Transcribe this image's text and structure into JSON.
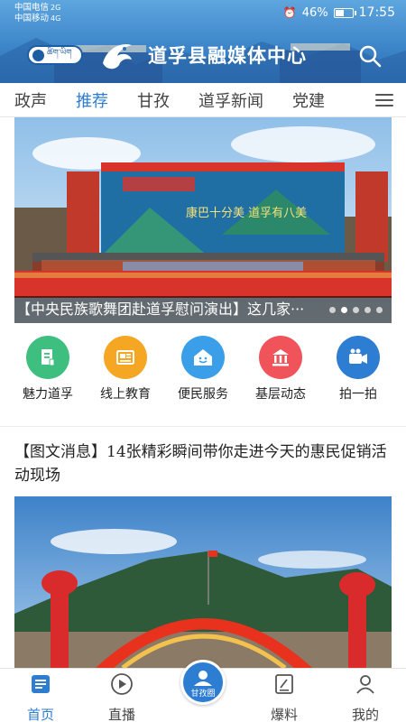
{
  "status_bar": {
    "carrier1": "中国电信",
    "carrier2": "中国移动",
    "net1": "2G",
    "net2": "4G",
    "battery": "46%",
    "time": "17:55"
  },
  "header": {
    "language_toggle": "ཚིག་ཡིག",
    "app_title": "道孚县融媒体中心"
  },
  "tabs": [
    {
      "label": "政声"
    },
    {
      "label": "推荐"
    },
    {
      "label": "甘孜"
    },
    {
      "label": "道孚新闻"
    },
    {
      "label": "党建"
    }
  ],
  "banner": {
    "caption": "【中央民族歌舞团赴道孚慰问演出】这几家···",
    "stage_text": "康巴十分美 道孚有八美",
    "slide_count": 5,
    "active_slide": 2
  },
  "quick_links": [
    {
      "label": "魅力道孚",
      "icon": "document-icon",
      "color": "#3fbf7f"
    },
    {
      "label": "线上教育",
      "icon": "newspaper-icon",
      "color": "#f5a623"
    },
    {
      "label": "便民服务",
      "icon": "smile-house-icon",
      "color": "#3a9ee8"
    },
    {
      "label": "基层动态",
      "icon": "institution-icon",
      "color": "#f0535a"
    },
    {
      "label": "拍一拍",
      "icon": "video-camera-icon",
      "color": "#2d7dd2"
    }
  ],
  "article": {
    "title": "【图文消息】14张精彩瞬间带你走进今天的惠民促销活动现场"
  },
  "bottom_nav": [
    {
      "label": "首页",
      "icon": "home-icon"
    },
    {
      "label": "直播",
      "icon": "play-icon"
    },
    {
      "label": "甘孜圈",
      "icon": "community-icon"
    },
    {
      "label": "爆料",
      "icon": "report-icon"
    },
    {
      "label": "我的",
      "icon": "user-icon"
    }
  ],
  "colors": {
    "accent": "#2d7dd2",
    "header": "#3d86c9"
  }
}
